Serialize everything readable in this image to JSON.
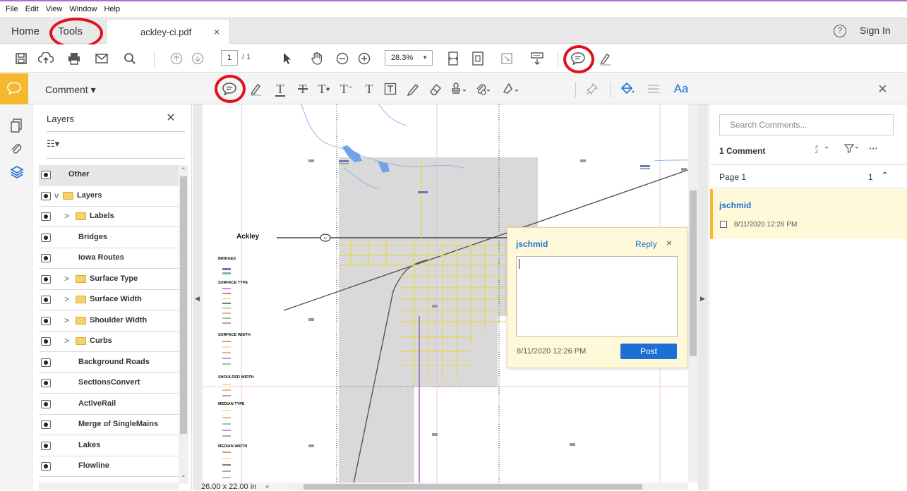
{
  "menubar": {
    "items": [
      "File",
      "Edit",
      "View",
      "Window",
      "Help"
    ]
  },
  "tabs": {
    "home": "Home",
    "tools": "Tools",
    "document": "ackley-ci.pdf",
    "close": "×"
  },
  "header": {
    "help": "?",
    "sign_in": "Sign In"
  },
  "toolbar": {
    "page_current": "1",
    "page_total": "/ 1",
    "zoom": "28.3%"
  },
  "comment_toolbar": {
    "label": "Comment ▾",
    "text_tool": "Aa",
    "close": "×"
  },
  "layers_panel": {
    "title": "Layers",
    "close": "×",
    "options": "☷▾",
    "items": [
      {
        "name": "Other",
        "indent": 0,
        "folder": false,
        "expand": ""
      },
      {
        "name": "Layers",
        "indent": 0,
        "folder": true,
        "expand": "v"
      },
      {
        "name": "Labels",
        "indent": 1,
        "folder": true,
        "expand": ">"
      },
      {
        "name": "Bridges",
        "indent": 1,
        "folder": false,
        "expand": ""
      },
      {
        "name": "Iowa Routes",
        "indent": 1,
        "folder": false,
        "expand": ""
      },
      {
        "name": "Surface Type",
        "indent": 1,
        "folder": true,
        "expand": ">"
      },
      {
        "name": "Surface Width",
        "indent": 1,
        "folder": true,
        "expand": ">"
      },
      {
        "name": "Shoulder Width",
        "indent": 1,
        "folder": true,
        "expand": ">"
      },
      {
        "name": "Curbs",
        "indent": 1,
        "folder": true,
        "expand": ">"
      },
      {
        "name": "Background Roads",
        "indent": 1,
        "folder": false,
        "expand": ""
      },
      {
        "name": "SectionsConvert",
        "indent": 1,
        "folder": false,
        "expand": ""
      },
      {
        "name": "ActiveRail",
        "indent": 1,
        "folder": false,
        "expand": ""
      },
      {
        "name": "Merge of SingleMains",
        "indent": 1,
        "folder": false,
        "expand": ""
      },
      {
        "name": "Lakes",
        "indent": 1,
        "folder": false,
        "expand": ""
      },
      {
        "name": "Flowline",
        "indent": 1,
        "folder": false,
        "expand": ""
      }
    ]
  },
  "document": {
    "page_size": "26.00 x 22.00 in",
    "map_title": "Ackley",
    "legend": {
      "bridges_heading": "BRIDGES",
      "surface_type_heading": "SURFACE TYPE",
      "surface_width_heading": "SURFACE WIDTH",
      "shoulder_width_heading": "SHOULDER WIDTH",
      "median_type_heading": "MEDIAN TYPE",
      "median_width_heading": "MEDIAN WIDTH"
    },
    "route_marker": "57"
  },
  "popup_note": {
    "author": "jschmid",
    "reply": "Reply",
    "close": "×",
    "timestamp": "8/11/2020  12:26 PM",
    "post": "Post"
  },
  "comments_pane": {
    "search_placeholder": "Search Comments...",
    "count_label": "1 Comment",
    "page_label": "Page 1",
    "page_comment_count": "1",
    "card_author": "jschmid",
    "card_timestamp": "8/11/2020  12:26 PM"
  },
  "colors": {
    "accent": "#1f6ed4",
    "comment_yellow": "#f5b82e",
    "annotation_red": "#e0111a",
    "note_background": "#fff9d9"
  }
}
